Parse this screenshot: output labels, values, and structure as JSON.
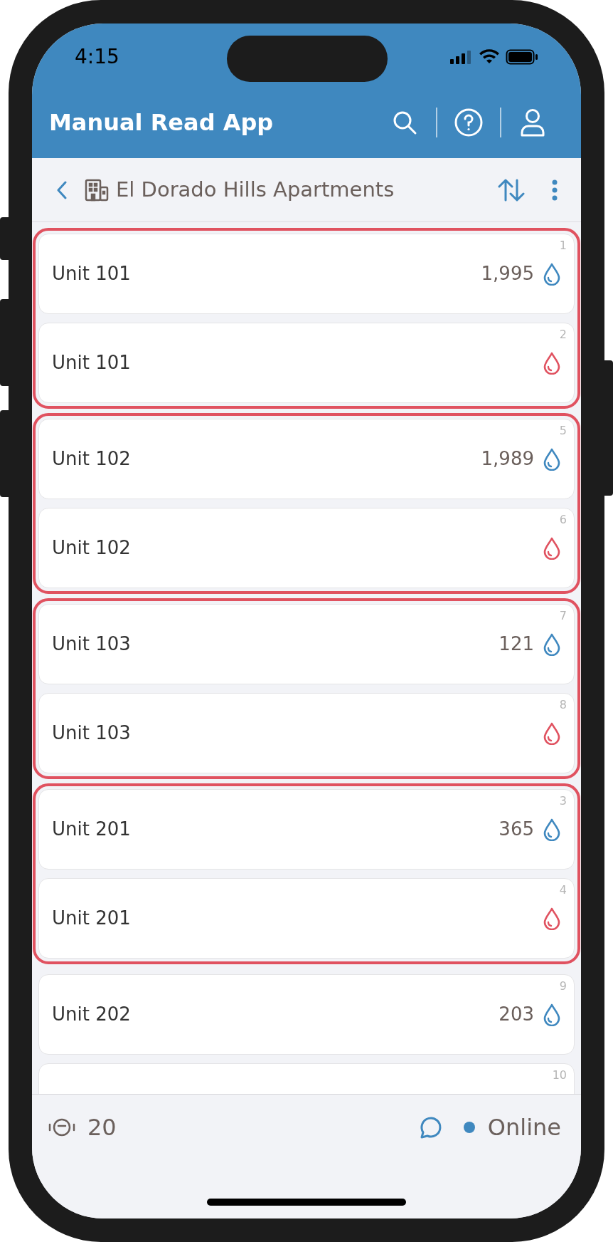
{
  "status_bar": {
    "time": "4:15"
  },
  "app_bar": {
    "title": "Manual Read App"
  },
  "nav": {
    "title": "El Dorado Hills Apartments"
  },
  "groups": [
    {
      "highlighted": true,
      "items": [
        {
          "kind": "read",
          "unit": "Unit 101",
          "reading": "1,995",
          "index": "1"
        },
        {
          "kind": "unread",
          "unit": "Unit 101",
          "index": "2"
        }
      ]
    },
    {
      "highlighted": true,
      "items": [
        {
          "kind": "read",
          "unit": "Unit 102",
          "reading": "1,989",
          "index": "5"
        },
        {
          "kind": "unread",
          "unit": "Unit 102",
          "index": "6"
        }
      ]
    },
    {
      "highlighted": true,
      "items": [
        {
          "kind": "read",
          "unit": "Unit 103",
          "reading": "121",
          "index": "7"
        },
        {
          "kind": "unread",
          "unit": "Unit 103",
          "index": "8"
        }
      ]
    },
    {
      "highlighted": true,
      "items": [
        {
          "kind": "read",
          "unit": "Unit 201",
          "reading": "365",
          "index": "3"
        },
        {
          "kind": "unread",
          "unit": "Unit 201",
          "index": "4"
        }
      ]
    },
    {
      "highlighted": false,
      "items": [
        {
          "kind": "read",
          "unit": "Unit 202",
          "reading": "203",
          "index": "9"
        },
        {
          "kind": "partial",
          "index": "10"
        }
      ]
    }
  ],
  "footer": {
    "count": "20",
    "status": "Online"
  }
}
